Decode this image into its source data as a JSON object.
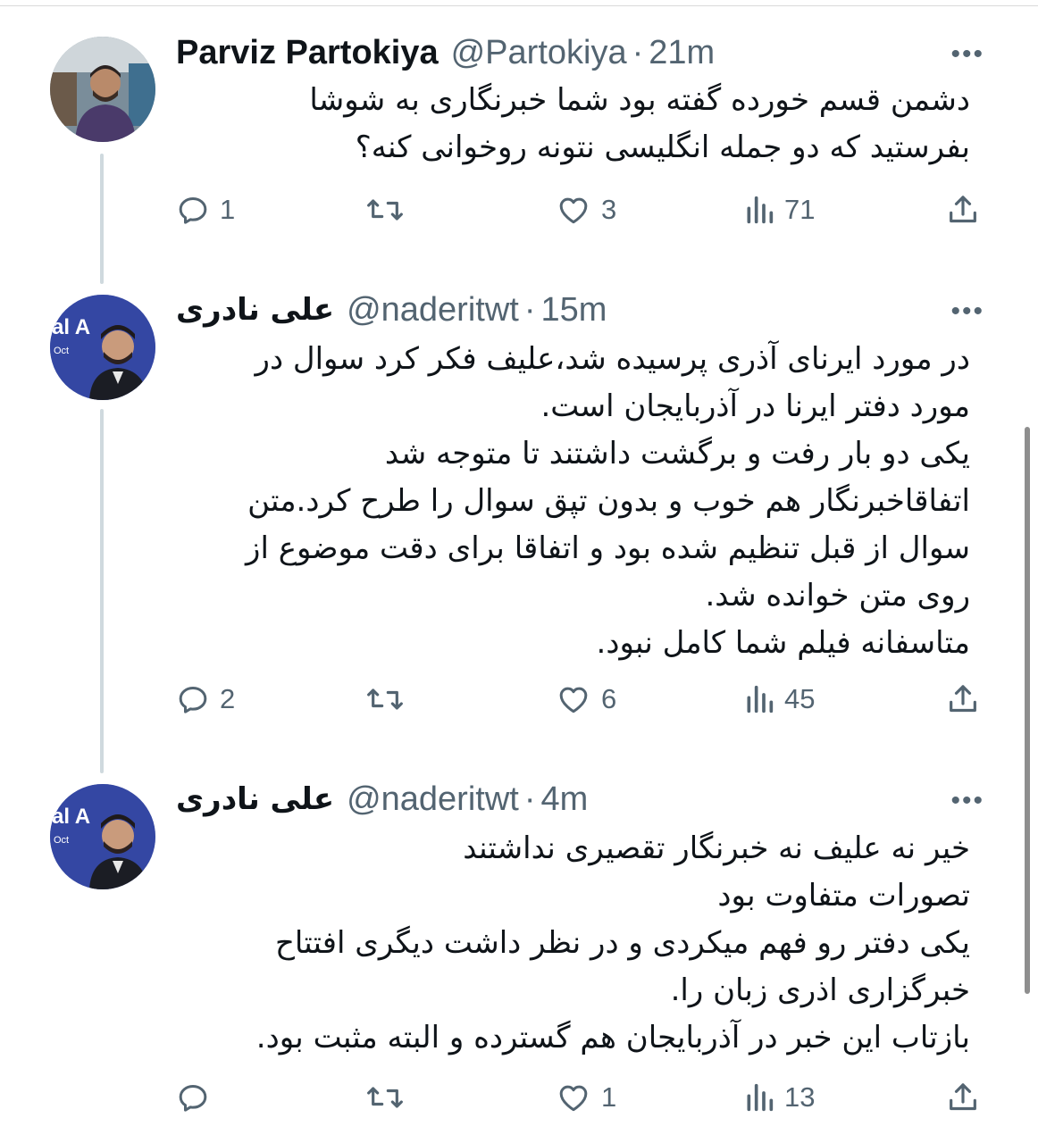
{
  "tweets": [
    {
      "name": "Parviz Partokiya",
      "handle": "@Partokiya",
      "separator": "·",
      "time": "21m",
      "more": "•••",
      "lines": [
        "دشمن قسم خورده گفته بود شما خبرنگاری به شوشا",
        "بفرستید که دو جمله انگلیسی نتونه روخوانی کنه؟"
      ],
      "replies": "1",
      "retweets": "",
      "likes": "3",
      "views": "71"
    },
    {
      "name": "علی نادری",
      "handle": "@naderitwt",
      "separator": "·",
      "time": "15m",
      "more": "•••",
      "lines": [
        "در مورد ایرنای آذری پرسیده شد،علیف فکر کرد سوال در",
        "مورد دفتر ایرنا در آذربایجان است.",
        "یکی دو بار رفت و برگشت داشتند تا متوجه شد",
        "اتفاقاخبرنگار هم خوب و بدون تپق سوال را طرح کرد.متن",
        "سوال از قبل تنظیم شده بود و اتفاقا برای دقت موضوع از",
        "روی متن خوانده شد.",
        "متاسفانه فیلم شما کامل نبود."
      ],
      "replies": "2",
      "retweets": "",
      "likes": "6",
      "views": "45"
    },
    {
      "name": "علی نادری",
      "handle": "@naderitwt",
      "separator": "·",
      "time": "4m",
      "more": "•••",
      "lines": [
        "خیر نه علیف نه خبرنگار تقصیری نداشتند",
        "تصورات متفاوت بود",
        "یکی دفتر رو فهم میکردی و در نظر داشت دیگری افتتاح",
        "خبرگزاری اذری زبان را.",
        "بازتاب این خبر در آذربایجان هم گسترده و البته مثبت بود."
      ],
      "replies": "",
      "retweets": "",
      "likes": "1",
      "views": "13"
    }
  ],
  "icons": {
    "reply": "reply-icon",
    "retweet": "retweet-icon",
    "like": "like-icon",
    "views": "views-icon",
    "share": "share-icon",
    "more": "more-icon"
  },
  "colors": {
    "text": "#0f1419",
    "secondary": "#536471",
    "thread_line": "#cfd9de"
  }
}
